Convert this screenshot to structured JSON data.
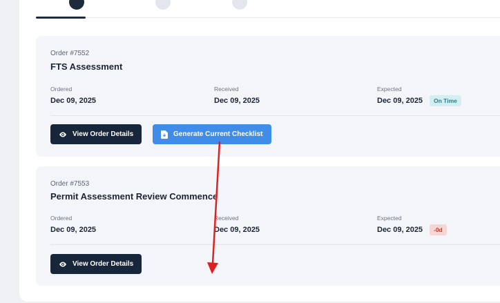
{
  "orders": [
    {
      "order_number": "Order #7552",
      "title": "FTS Assessment",
      "ordered_label": "Ordered",
      "ordered_value": "Dec 09, 2025",
      "received_label": "Received",
      "received_value": "Dec 09, 2025",
      "expected_label": "Expected",
      "expected_value": "Dec 09, 2025",
      "status_badge": "On Time",
      "view_button": "View Order Details",
      "checklist_button": "Generate Current Checklist"
    },
    {
      "order_number": "Order #7553",
      "title": "Permit Assessment Review Commence",
      "ordered_label": "Ordered",
      "ordered_value": "Dec 09, 2025",
      "received_label": "Received",
      "received_value": "Dec 09, 2025",
      "expected_label": "Expected",
      "expected_value": "Dec 09, 2025",
      "status_badge": "-0d",
      "view_button": "View Order Details"
    }
  ],
  "colors": {
    "dark_button": "#17263a",
    "blue_button": "#3f8de8",
    "on_time_badge_bg": "#d3eef0",
    "late_badge_bg": "#f6d5d5",
    "annotation_arrow": "#e02020"
  },
  "icons": {
    "view_button_icon": "eye-icon",
    "checklist_button_icon": "document-download-icon"
  }
}
